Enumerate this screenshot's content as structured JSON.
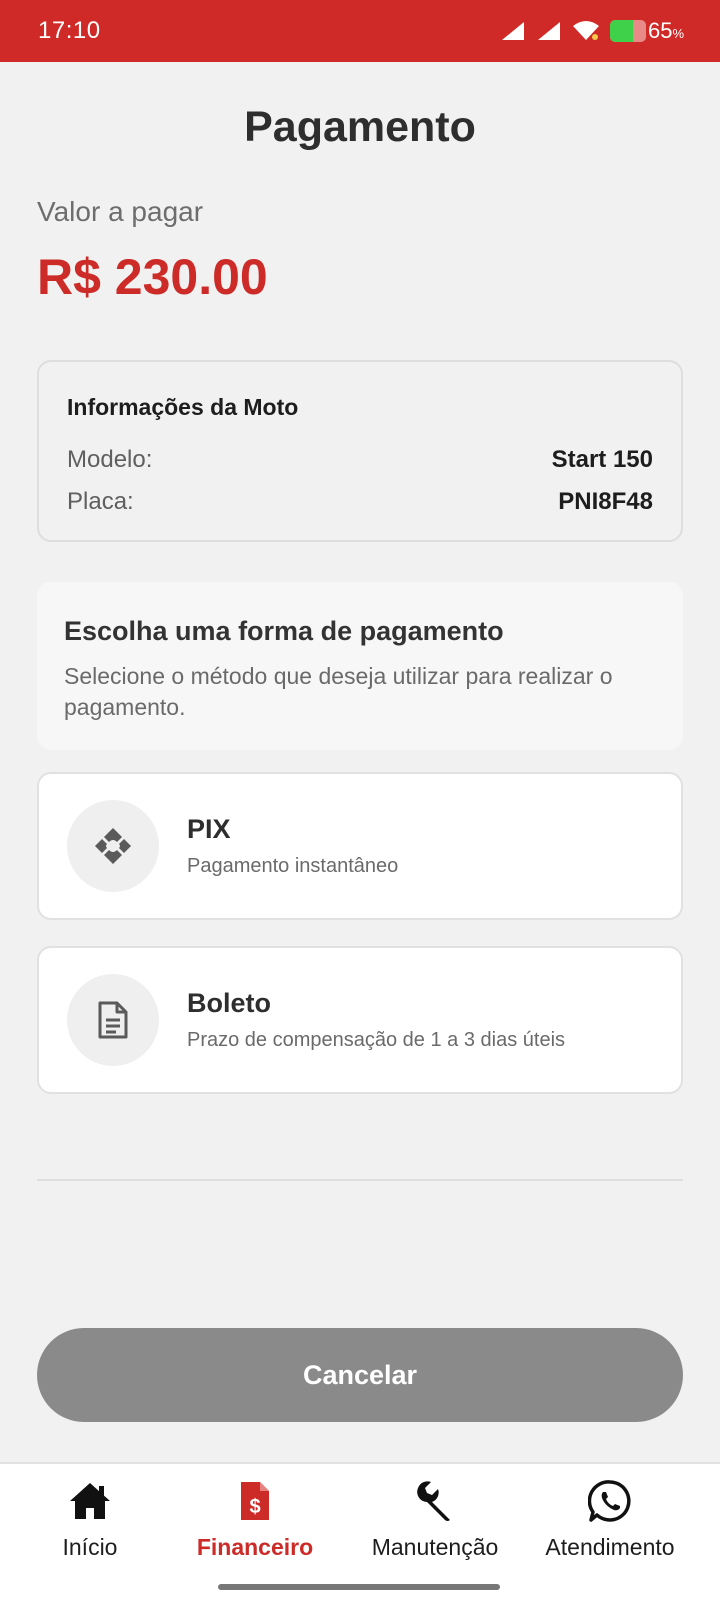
{
  "status_bar": {
    "time": "17:10",
    "battery_percent": "65",
    "battery_unit": "%",
    "battery_level": 0.65
  },
  "header": {
    "title": "Pagamento"
  },
  "amount": {
    "label": "Valor a pagar",
    "value": "R$ 230.00"
  },
  "moto_info": {
    "title": "Informações da Moto",
    "rows": [
      {
        "key": "Modelo:",
        "value": "Start 150"
      },
      {
        "key": "Placa:",
        "value": "PNI8F48"
      }
    ]
  },
  "payment_prompt": {
    "title": "Escolha uma forma de pagamento",
    "description": "Selecione o método que deseja utilizar para realizar o pagamento."
  },
  "methods": [
    {
      "name": "PIX",
      "description": "Pagamento instantâneo",
      "icon": "pix-icon"
    },
    {
      "name": "Boleto",
      "description": "Prazo de compensação de 1 a 3 dias úteis",
      "icon": "document-icon"
    }
  ],
  "cancel_label": "Cancelar",
  "nav": {
    "items": [
      {
        "label": "Início",
        "icon": "home-icon",
        "active": false
      },
      {
        "label": "Financeiro",
        "icon": "invoice-dollar-icon",
        "active": true
      },
      {
        "label": "Manutenção",
        "icon": "wrench-icon",
        "active": false
      },
      {
        "label": "Atendimento",
        "icon": "whatsapp-icon",
        "active": false
      }
    ]
  },
  "colors": {
    "brand_red": "#cc2b27",
    "status_bar": "#cf2a27",
    "cancel_button": "#8a8a8a",
    "background": "#f1f1f1"
  }
}
